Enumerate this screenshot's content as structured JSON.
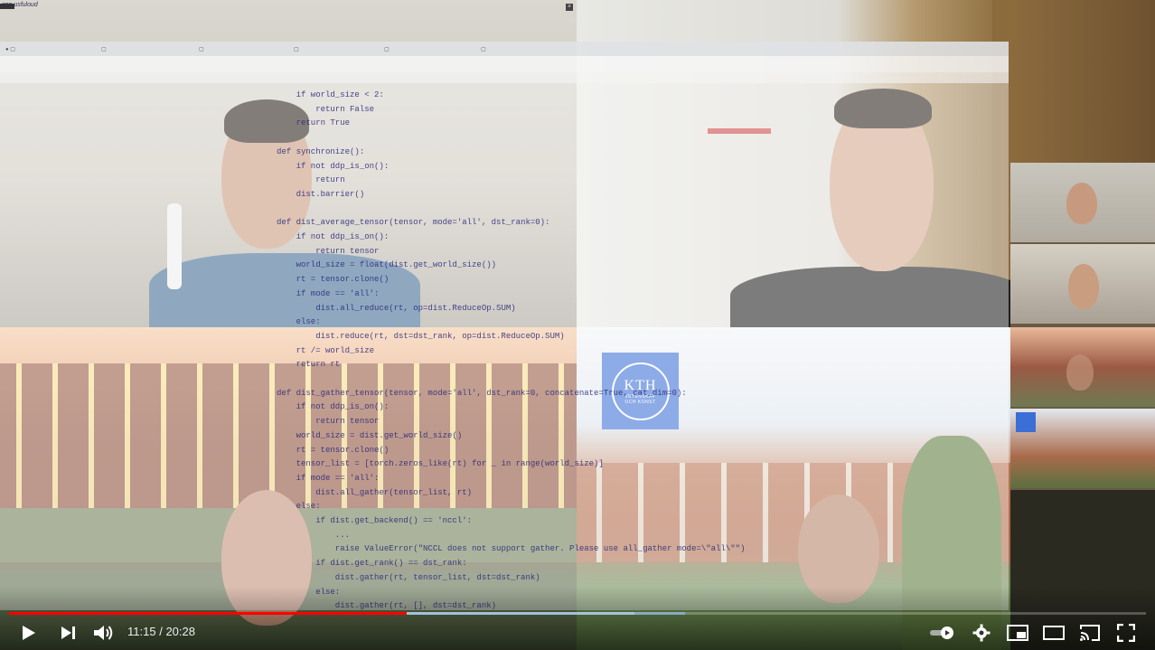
{
  "player": {
    "time_current": "11:15",
    "time_separator": "/",
    "time_total": "20:28",
    "progress_played": 0.35,
    "progress_loaded": 0.55,
    "colors": {
      "played": "#ff0000",
      "accent": "#3c6fd6"
    }
  },
  "overlay": {
    "kth_logo_big": "KTH",
    "kth_logo_small1": "VETENSKAP",
    "kth_logo_small2": "OCH KONST",
    "corner_note": "ʙnp usfuloud"
  },
  "code_lines": [
    {
      "n": "",
      "t": "    if world_size < 2:"
    },
    {
      "n": "",
      "t": "        return False"
    },
    {
      "n": "",
      "t": "    return True"
    },
    {
      "n": "",
      "t": ""
    },
    {
      "n": "",
      "t": "def synchronize():"
    },
    {
      "n": "",
      "t": "    if not ddp_is_on():"
    },
    {
      "n": "",
      "t": "        return"
    },
    {
      "n": "",
      "t": "    dist.barrier()"
    },
    {
      "n": "",
      "t": ""
    },
    {
      "n": "",
      "t": "def dist_average_tensor(tensor, mode='all', dst_rank=0):"
    },
    {
      "n": "",
      "t": "    if not ddp_is_on():"
    },
    {
      "n": "",
      "t": "        return tensor"
    },
    {
      "n": "",
      "t": "    world_size = float(dist.get_world_size())"
    },
    {
      "n": "",
      "t": "    rt = tensor.clone()"
    },
    {
      "n": "",
      "t": "    if mode == 'all':"
    },
    {
      "n": "",
      "t": "        dist.all_reduce(rt, op=dist.ReduceOp.SUM)"
    },
    {
      "n": "",
      "t": "    else:"
    },
    {
      "n": "",
      "t": "        dist.reduce(rt, dst=dst_rank, op=dist.ReduceOp.SUM)"
    },
    {
      "n": "",
      "t": "    rt /= world_size"
    },
    {
      "n": "",
      "t": "    return rt"
    },
    {
      "n": "",
      "t": ""
    },
    {
      "n": "",
      "t": "def dist_gather_tensor(tensor, mode='all', dst_rank=0, concatenate=True, cat_dim=0):"
    },
    {
      "n": "",
      "t": "    if not ddp_is_on():"
    },
    {
      "n": "",
      "t": "        return tensor"
    },
    {
      "n": "",
      "t": "    world_size = dist.get_world_size()"
    },
    {
      "n": "",
      "t": "    rt = tensor.clone()"
    },
    {
      "n": "",
      "t": "    tensor_list = [torch.zeros_like(rt) for _ in range(world_size)]"
    },
    {
      "n": "",
      "t": "    if mode == 'all':"
    },
    {
      "n": "",
      "t": "        dist.all_gather(tensor_list, rt)"
    },
    {
      "n": "",
      "t": "    else:"
    },
    {
      "n": "",
      "t": "        if dist.get_backend() == 'nccl':"
    },
    {
      "n": "",
      "t": "            ..."
    },
    {
      "n": "",
      "t": "            raise ValueError(\"NCCL does not support gather. Please use all_gather mode=\\\"all\\\"\")"
    },
    {
      "n": "",
      "t": "        if dist.get_rank() == dst_rank:"
    },
    {
      "n": "",
      "t": "            dist.gather(rt, tensor_list, dst=dst_rank)"
    },
    {
      "n": "",
      "t": "        else:"
    },
    {
      "n": "",
      "t": "            dist.gather(rt, [], dst=dst_rank)"
    }
  ]
}
